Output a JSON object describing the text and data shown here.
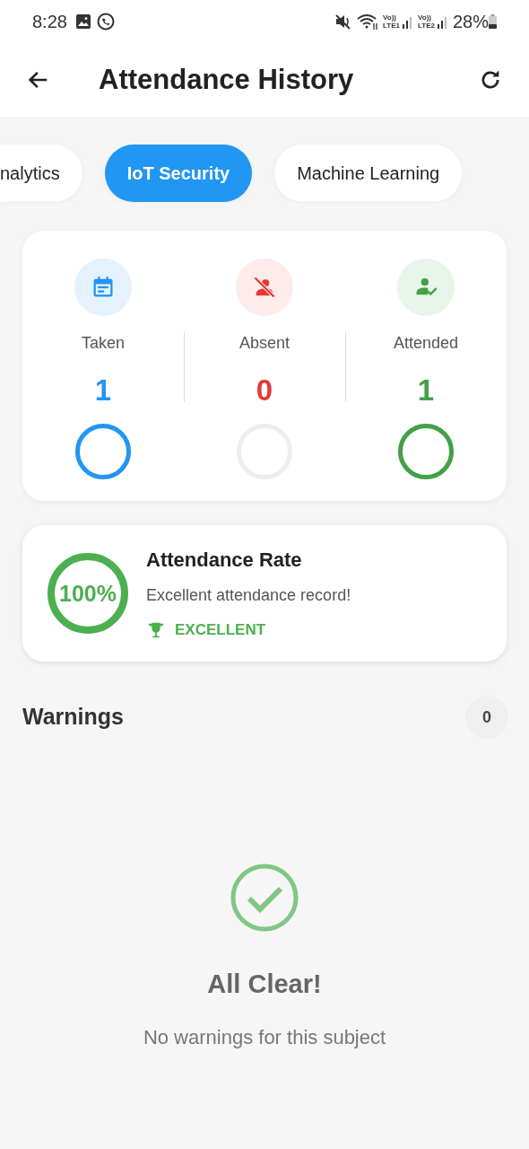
{
  "status_bar": {
    "time": "8:28",
    "volte_1": "Vo))",
    "lte_1": "LTE1",
    "volte_2": "Vo))",
    "lte_2": "LTE2",
    "battery": "28%"
  },
  "app_bar": {
    "title": "Attendance History"
  },
  "tabs": [
    {
      "label": "nalytics",
      "selected": false
    },
    {
      "label": "IoT Security",
      "selected": true
    },
    {
      "label": "Machine Learning",
      "selected": false
    }
  ],
  "stats": [
    {
      "kind": "taken",
      "label": "Taken",
      "value": "1",
      "color": "#2196f3"
    },
    {
      "kind": "absent",
      "label": "Absent",
      "value": "0",
      "color": "#e53935"
    },
    {
      "kind": "attended",
      "label": "Attended",
      "value": "1",
      "color": "#43a047"
    }
  ],
  "rate": {
    "percent": "100%",
    "title": "Attendance Rate",
    "message": "Excellent attendance record!",
    "badge": "EXCELLENT"
  },
  "warnings": {
    "title": "Warnings",
    "count": "0",
    "empty_title": "All Clear!",
    "empty_message": "No warnings for this subject"
  }
}
